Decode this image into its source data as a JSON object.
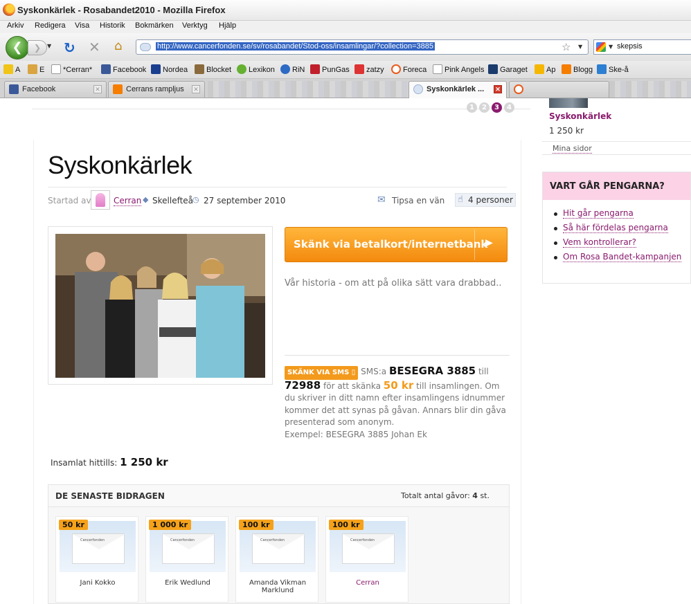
{
  "window": {
    "title": "Syskonkärlek - Rosabandet2010 - Mozilla Firefox"
  },
  "menu": [
    "Arkiv",
    "Redigera",
    "Visa",
    "Historik",
    "Bokmärken",
    "Verktyg",
    "Hjälp"
  ],
  "nav": {
    "url": "http://www.cancerfonden.se/sv/rosabandet/Stod-oss/insamlingar/?collection=3885",
    "search_value": "skepsis"
  },
  "bookmarks": [
    "A",
    "E",
    "*Cerran*",
    "Facebook",
    "Nordea",
    "Blocket",
    "Lexikon",
    "RiN",
    "PunGas",
    "zatzy",
    "Foreca",
    "Pink Angels",
    "Garaget",
    "Ap",
    "Blogg",
    "Ske-å"
  ],
  "tabs": [
    {
      "label": "Facebook"
    },
    {
      "label": "Cerrans rampljus"
    },
    {
      "label": "Syskonkärlek ..."
    }
  ],
  "pager": [
    "1",
    "2",
    "3",
    "4"
  ],
  "collection": {
    "title": "Syskonkärlek",
    "started_by_label": "Startad av:",
    "user": "Cerran",
    "location": "Skellefteå",
    "date": "27 september 2010",
    "tip_label": "Tipsa en vän",
    "likes": "4 personer",
    "donate_button": "Skänk via betalkort/internetbank",
    "story": "Vår historia - om att på olika sätt vara drabbad..",
    "sms": {
      "badge": "SKÄNK VIA SMS",
      "t1": "SMS:a",
      "keyword": "BESEGRA 3885",
      "t2": "till",
      "number": "72988",
      "t3": "för att skänka",
      "amount": "50 kr",
      "t4": "till insamlingen. Om du skriver in ditt namn efter insamlingens idnummer kommer det att synas på gåvan. Annars blir din gåva presenterad som anonym.",
      "example": "Exempel: BESEGRA 3885 Johan Ek"
    },
    "collected_label": "Insamlat hittills:",
    "collected_value": "1 250 kr"
  },
  "recent": {
    "title": "DE SENASTE BIDRAGEN",
    "total_label": "Totalt antal gåvor:",
    "total_value": "4",
    "total_unit": "st.",
    "brand": "Cancerfonden",
    "gifts": [
      {
        "amount": "50 kr",
        "name": "Jani Kokko"
      },
      {
        "amount": "1 000 kr",
        "name": "Erik Wedlund"
      },
      {
        "amount": "100 kr",
        "name": "Amanda Vikman Marklund"
      },
      {
        "amount": "100 kr",
        "name": "Cerran"
      }
    ]
  },
  "sidebar": {
    "name": "Syskonkärlek",
    "amount": "1 250 kr",
    "my_pages": "Mina sidor",
    "box_title": "VART GÅR PENGARNA?",
    "links": [
      "Hit går pengarna",
      "Så här fördelas pengarna",
      "Vem kontrollerar?",
      "Om Rosa Bandet-kampanjen"
    ]
  },
  "colors": {
    "accent": "#8a1b6e",
    "orange": "#f39a1c",
    "pink_header": "#fbd2e6"
  }
}
